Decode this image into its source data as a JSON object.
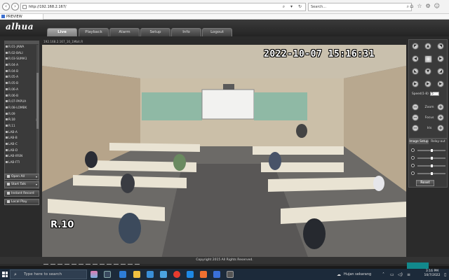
{
  "browser": {
    "url": "http://192.168.2.167/",
    "search_placeholder": "Search...",
    "tab_title": "PREVIEW"
  },
  "app": {
    "logo": "alhua",
    "menu": [
      {
        "label": "Live",
        "active": true
      },
      {
        "label": "Playback",
        "active": false
      },
      {
        "label": "Alarm",
        "active": false
      },
      {
        "label": "Setup",
        "active": false
      },
      {
        "label": "Info",
        "active": false
      },
      {
        "label": "Logout",
        "active": false
      }
    ]
  },
  "cameras": [
    {
      "label": "R.01-JAWA"
    },
    {
      "label": "R.02-BALI"
    },
    {
      "label": "R.03-SUMA1"
    },
    {
      "label": "R.04-A"
    },
    {
      "label": "R.04-B"
    },
    {
      "label": "R.05-A"
    },
    {
      "label": "R.05-B"
    },
    {
      "label": "R.06-A"
    },
    {
      "label": "R.06-B"
    },
    {
      "label": "R.07-PAPUA"
    },
    {
      "label": "R.08-LOMBK"
    },
    {
      "label": "R.09"
    },
    {
      "label": "R.10",
      "badge": "M",
      "selected": true
    },
    {
      "label": "R.11"
    },
    {
      "label": "LAB-A"
    },
    {
      "label": "LAB-B"
    },
    {
      "label": "LAB-C"
    },
    {
      "label": "LAB-D"
    },
    {
      "label": "LAB-IRSN"
    },
    {
      "label": "LAB-FTI"
    }
  ],
  "side_buttons": {
    "open_all": "Open All",
    "start_talk": "Start Talk",
    "instant_record": "Instant Record",
    "local_play": "Local Play"
  },
  "video": {
    "info": "192.168.2.167_10_1Mbit.R",
    "timestamp": "2022-10-07 15:16:31",
    "channel_name": "R.10"
  },
  "ptz": {
    "speed_label": "Speed(1-8)",
    "speed_value": "5",
    "zoom_label": "Zoom",
    "focus_label": "Focus",
    "iris_label": "Iris"
  },
  "image_setup": {
    "tab_image": "Image Setup",
    "tab_relay": "Relay-out",
    "reset": "Reset",
    "sliders": [
      {
        "icon": "brightness-icon",
        "level": 0.5
      },
      {
        "icon": "contrast-icon",
        "level": 0.5
      },
      {
        "icon": "hue-icon",
        "level": 0.5
      },
      {
        "icon": "saturation-icon",
        "level": 0.5
      }
    ]
  },
  "footer": {
    "copyright": "Copyright 2015 All Rights Reserved."
  },
  "taskbar": {
    "search_placeholder": "Type here to search",
    "weather": "Hujan sekarang",
    "time": "3:16 PM",
    "date": "10/7/2022"
  }
}
